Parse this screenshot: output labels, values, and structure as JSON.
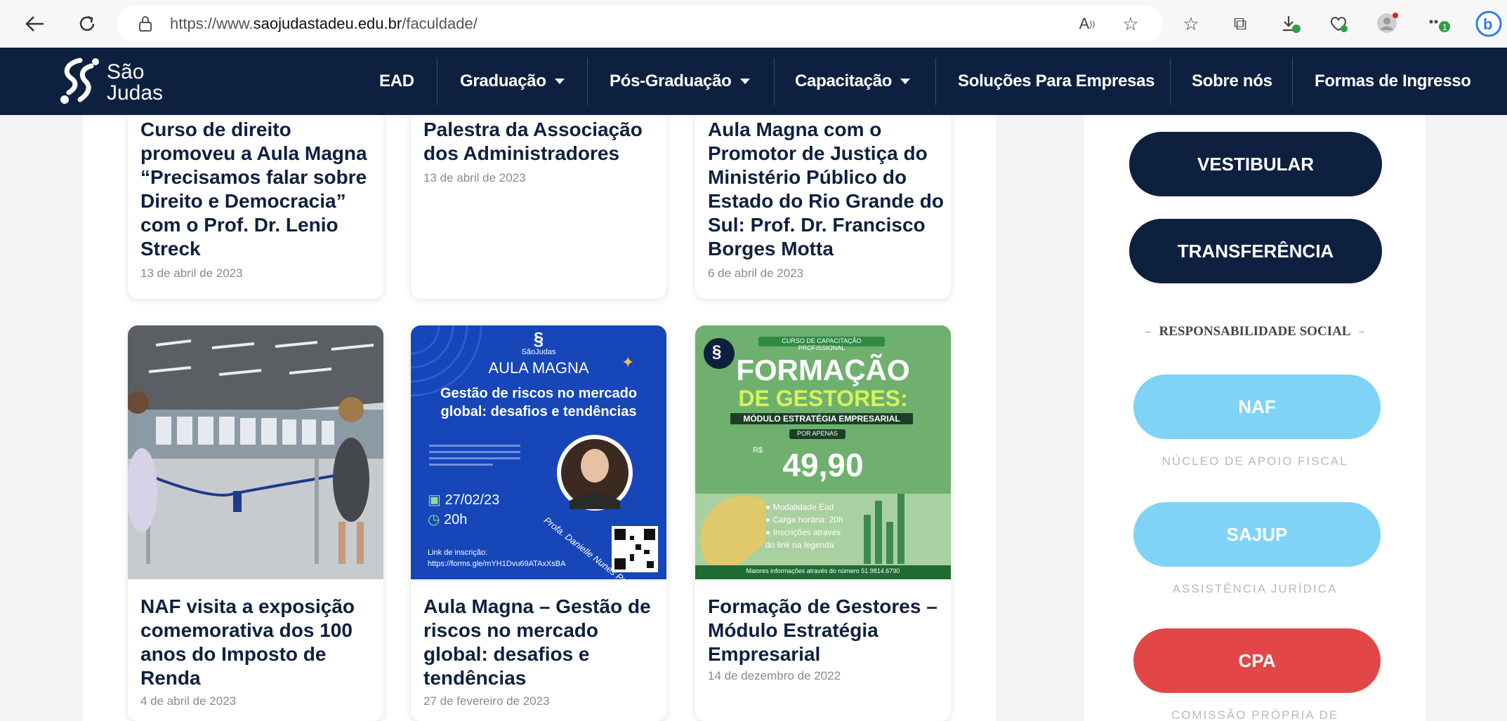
{
  "browser": {
    "url_prefix": "https://www.",
    "url_domain": "saojudastadeu.edu.br",
    "url_path": "/faculdade/"
  },
  "site": {
    "logo_line1": "São",
    "logo_line2": "Judas",
    "nav": [
      {
        "label": "EAD"
      },
      {
        "label": "Graduação"
      },
      {
        "label": "Pós-Graduação"
      },
      {
        "label": "Capacitação"
      },
      {
        "label": "Soluções Para Empresas"
      },
      {
        "label": "Sobre nós"
      },
      {
        "label": "Formas de Ingresso"
      }
    ]
  },
  "posts": [
    {
      "title": "Curso de direito promoveu a Aula Magna “Precisamos falar sobre Direito e Democracia” com o Prof. Dr. Lenio Streck",
      "date": "13 de abril de 2023"
    },
    {
      "title": "Palestra da Associação dos Administradores",
      "date": "13 de abril de 2023"
    },
    {
      "title": "Aula Magna com o Promotor de Justiça  do Ministério Público do Estado do Rio Grande do Sul: Prof. Dr. Francisco Borges Motta",
      "date": "6 de abril de 2023"
    },
    {
      "title": "NAF visita a exposição comemorativa dos 100 anos do Imposto de Renda",
      "date": "4 de abril de 2023"
    },
    {
      "title": "Aula Magna – Gestão de riscos no mercado global: desafios e tendências",
      "date": "27 de fevereiro de 2023"
    },
    {
      "title": "Formação de Gestores – Módulo Estratégia Empresarial",
      "date": "14 de dezembro de 2022"
    }
  ],
  "poster_aula": {
    "brand": "SãoJudas",
    "heading": "AULA MAGNA",
    "subtitle": "Gestão de riscos no mercado global: desafios e tendências",
    "date": "27/02/23",
    "time": "20h",
    "speaker": "Profa. Danielle Nunes Pozzo",
    "link_label": "Link de inscrição:",
    "link": "https://forms.gle/mYH1Dvu69ATAxXsBA"
  },
  "poster_formacao": {
    "top_label": "CURSO DE CAPACITAÇÃO PROFISSIONAL",
    "title1": "FORMAÇÃO",
    "title2": "DE GESTORES:",
    "module": "MÓDULO ESTRATÉGIA EMPRESARIAL",
    "por_apenas": "POR APENAS",
    "currency": "R$",
    "price": "49,90",
    "bullets": [
      "Modalidade Ead",
      "Carga horária: 20h",
      "Inscrições através do link na legenda"
    ],
    "footer": "Maiores informações através do número 51.9814.6790"
  },
  "sidebar": {
    "vestibular": "VESTIBULAR",
    "transferencia": "TRANSFERÊNCIA",
    "section": "RESPONSABILIDADE SOCIAL",
    "naf": "NAF",
    "naf_desc": "NÚCLEO DE APOIO FISCAL",
    "sajup": "SAJUP",
    "sajup_desc": "ASSISTÊNCIA JURÍDICA",
    "cpa": "CPA",
    "cpa_desc": "COMISSÃO PRÓPRIA DE"
  },
  "colors": {
    "navy": "#0e2040",
    "light_blue": "#7fd3f6",
    "red": "#e24646",
    "poster_blue": "#1646b8",
    "poster_green": "#5aa86a"
  }
}
